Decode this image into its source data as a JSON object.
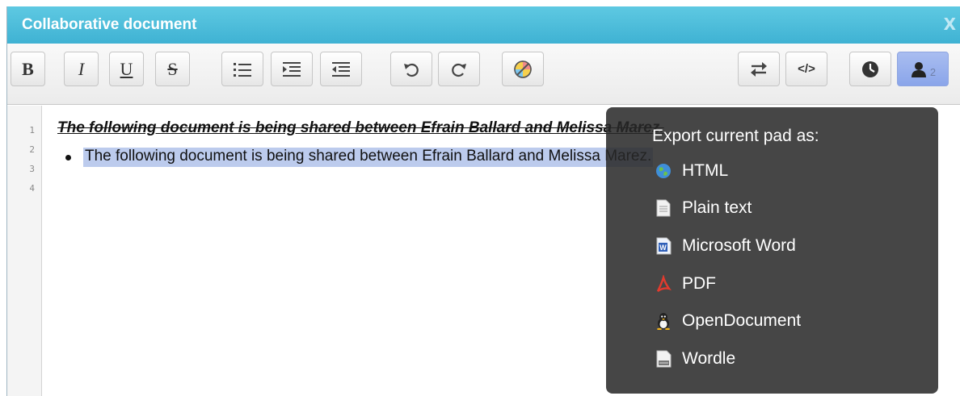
{
  "window": {
    "title": "Collaborative document",
    "close_label": "X"
  },
  "toolbar": {
    "bold": "bold-icon",
    "italic": "italic-icon",
    "underline": "underline-icon",
    "strikethrough": "strikethrough-icon",
    "unordered_list": "list-icon",
    "indent": "indent-icon",
    "outdent": "outdent-icon",
    "undo": "undo-icon",
    "redo": "redo-icon",
    "color": "color-icon",
    "import_export": "import-export-icon",
    "embed": "embed-icon",
    "embed_label": "</>",
    "history": "clock-icon",
    "users": "user-icon",
    "user_count": "2"
  },
  "editor": {
    "line_numbers": [
      "1",
      "2",
      "3",
      "4"
    ],
    "line1": "The following document is being shared between Efrain Ballard and Melissa Marez.",
    "line2": "The following document is being shared between Efrain Ballard and Melissa Marez."
  },
  "export_popup": {
    "title": "Export current pad as:",
    "items": [
      {
        "label": "HTML",
        "icon": "html-globe-icon"
      },
      {
        "label": "Plain text",
        "icon": "text-file-icon"
      },
      {
        "label": "Microsoft Word",
        "icon": "word-icon"
      },
      {
        "label": "PDF",
        "icon": "pdf-icon"
      },
      {
        "label": "OpenDocument",
        "icon": "opendocument-icon"
      },
      {
        "label": "Wordle",
        "icon": "wordle-icon"
      }
    ]
  },
  "colors": {
    "titlebar": "#4fbedb",
    "selection": "#bccbed",
    "active_button": "#9cb2ee",
    "popup_bg": "#3a3a3a"
  }
}
